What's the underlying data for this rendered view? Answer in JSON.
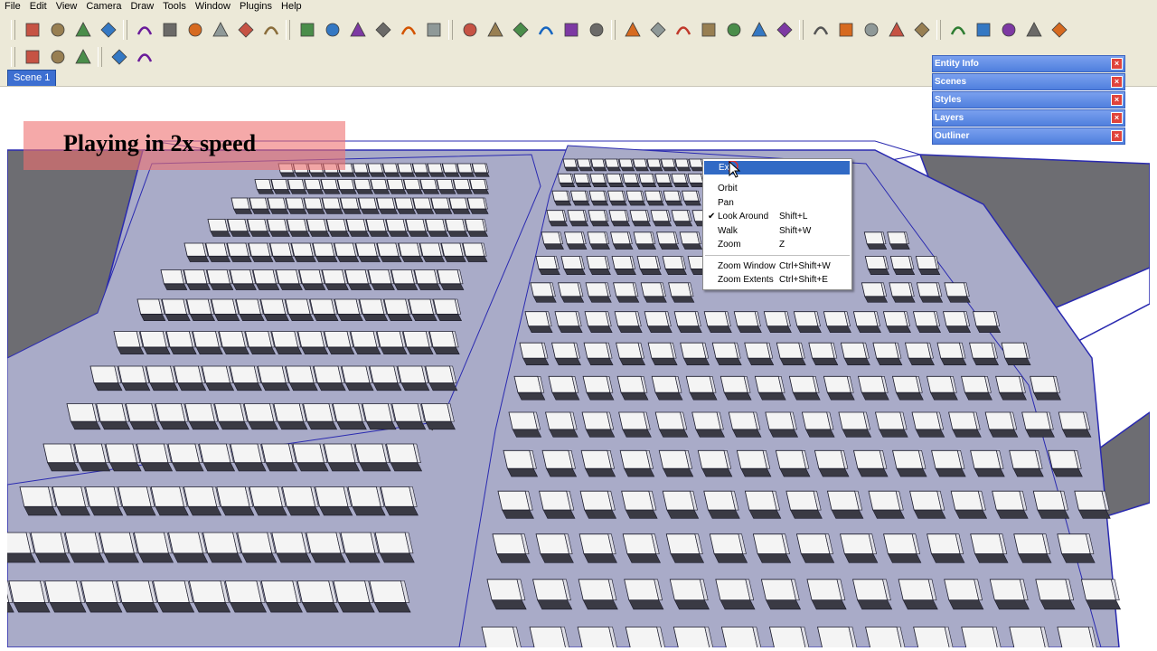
{
  "menu": [
    "File",
    "Edit",
    "View",
    "Camera",
    "Draw",
    "Tools",
    "Window",
    "Plugins",
    "Help"
  ],
  "toolbar_icons_row1": [
    "select-icon",
    "component-icon",
    "paint-bucket-icon",
    "eraser-icon",
    "rectangle-icon",
    "line-pencil-icon",
    "circle-icon",
    "arc-icon",
    "polygon-icon",
    "freehand-icon",
    "move-icon",
    "push-pull-icon",
    "rotate-icon",
    "follow-me-icon",
    "scale-icon",
    "offset-icon",
    "tape-measure-icon",
    "dimension-icon",
    "protractor-icon",
    "text-icon",
    "axes-icon",
    "3d-text-icon",
    "orbit-icon",
    "pan-icon",
    "zoom-icon",
    "zoom-window-icon",
    "zoom-extents-icon",
    "previous-view-icon",
    "position-camera-icon",
    "look-around-icon",
    "walk-icon",
    "section-plane-icon",
    "sandbox-contours-icon",
    "sandbox-scratch-icon",
    "sandbox-smoove-icon",
    "sandbox-stamp-icon",
    "sandbox-drape-icon",
    "sandbox-detail-icon",
    "sandbox-flip-icon"
  ],
  "toolbar_icons_row2": [
    "get-current-view-icon",
    "toggle-terrain-icon",
    "place-model-icon",
    "get-models-icon",
    "share-model-icon"
  ],
  "scene_tab": "Scene 1",
  "overlay_text": "Playing in 2x speed",
  "trays": [
    {
      "title": "Entity Info"
    },
    {
      "title": "Scenes"
    },
    {
      "title": "Styles"
    },
    {
      "title": "Layers"
    },
    {
      "title": "Outliner"
    }
  ],
  "context_menu": {
    "items": [
      {
        "label": "Exit",
        "shortcut": "",
        "checked": false,
        "highlighted": true
      },
      {
        "label": "Orbit",
        "shortcut": "",
        "checked": false,
        "highlighted": false
      },
      {
        "label": "Pan",
        "shortcut": "",
        "checked": false,
        "highlighted": false
      },
      {
        "label": "Look Around",
        "shortcut": "Shift+L",
        "checked": true,
        "highlighted": false
      },
      {
        "label": "Walk",
        "shortcut": "Shift+W",
        "checked": false,
        "highlighted": false
      },
      {
        "label": "Zoom",
        "shortcut": "Z",
        "checked": false,
        "highlighted": false
      },
      {
        "label": "Zoom Window",
        "shortcut": "Ctrl+Shift+W",
        "checked": false,
        "highlighted": false
      },
      {
        "label": "Zoom Extents",
        "shortcut": "Ctrl+Shift+E",
        "checked": false,
        "highlighted": false
      }
    ]
  },
  "colors": {
    "floor": "#a9abc8",
    "wall": "#6d6d72",
    "seat": "#f4f4f4",
    "seat_edge": "#1a1a2a",
    "edge_blue": "#2a2ab0",
    "highlight": "#316ac5",
    "banner": "#ee7070"
  }
}
